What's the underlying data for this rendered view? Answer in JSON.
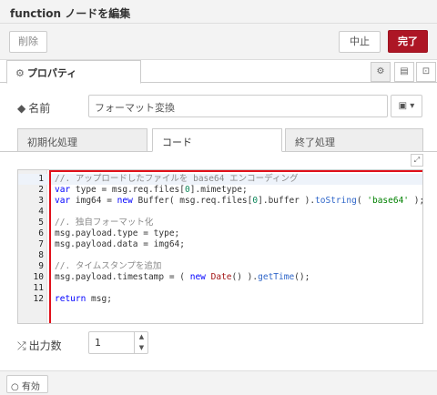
{
  "tray": {
    "title": "function ノードを編集"
  },
  "toolbar": {
    "delete_label": "削除",
    "cancel_label": "中止",
    "done_label": "完了"
  },
  "tabs": {
    "properties_label": "プロパティ"
  },
  "form": {
    "name_label": "名前",
    "name_value": "フォーマット変換",
    "outputs_label": "出力数",
    "outputs_value": "1"
  },
  "subtabs": [
    "初期化処理",
    "コード",
    "終了処理"
  ],
  "editor": {
    "lines": [
      {
        "n": "1",
        "html": "<span class='cm'>//. アップロードしたファイルを base64 エンコーディング</span>"
      },
      {
        "n": "2",
        "html": "<span class='kw'>var</span> type = msg.req.files[<span class='num'>0</span>].mimetype;"
      },
      {
        "n": "3",
        "html": "<span class='kw'>var</span> img64 = <span class='kw'>new</span> Buffer( msg.req.files[<span class='num'>0</span>].buffer ).<span class='fn'>toString</span>( <span class='str'>'base64'</span> );"
      },
      {
        "n": "4",
        "html": ""
      },
      {
        "n": "5",
        "html": "<span class='cm'>//. 独自フォーマット化</span>"
      },
      {
        "n": "6",
        "html": "msg.payload.type = type;"
      },
      {
        "n": "7",
        "html": "msg.payload.data = img64;"
      },
      {
        "n": "8",
        "html": ""
      },
      {
        "n": "9",
        "html": "<span class='cm'>//. タイムスタンプを追加</span>"
      },
      {
        "n": "10",
        "html": "msg.payload.timestamp = ( <span class='kw'>new</span> <span class='cls'>Date</span>() ).<span class='fn'>getTime</span>();"
      },
      {
        "n": "11",
        "html": ""
      },
      {
        "n": "12",
        "html": "<span class='kw'>return</span> msg;"
      }
    ]
  },
  "footer": {
    "enable_label": "有効"
  }
}
